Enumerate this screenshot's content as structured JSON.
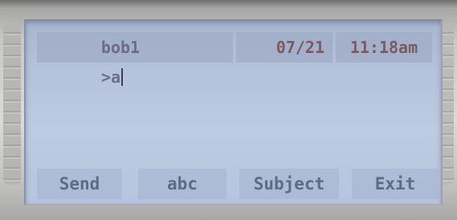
{
  "header": {
    "name": "bob1",
    "date": "07/21",
    "time": "11:18am"
  },
  "entry": {
    "text": ">a"
  },
  "softkeys": [
    {
      "label": "Send"
    },
    {
      "label": "abc"
    },
    {
      "label": "Subject"
    },
    {
      "label": "Exit"
    }
  ],
  "colors": {
    "screen_background": "#b3c1da",
    "header_text": "#6c6c8a",
    "datetime_text": "#7a5b63",
    "softkey_text": "#5e6a8a"
  }
}
